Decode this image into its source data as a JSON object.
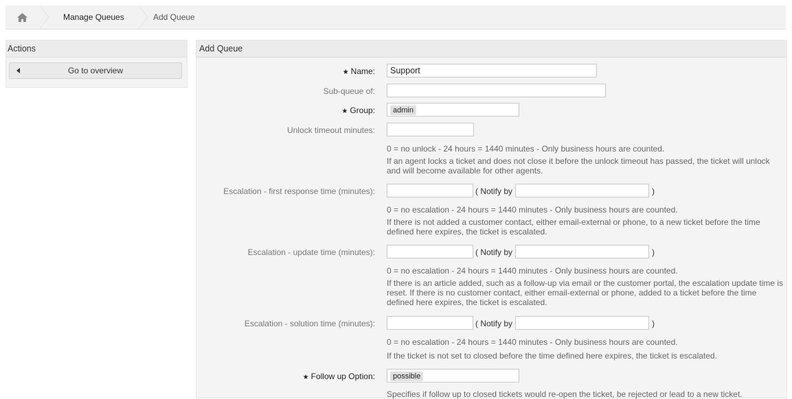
{
  "breadcrumb": {
    "home_icon": "home-icon",
    "items": [
      "Manage Queues",
      "Add Queue"
    ]
  },
  "sidebar": {
    "title": "Actions",
    "button_label": "Go to overview"
  },
  "main": {
    "title": "Add Queue",
    "fields": {
      "name": {
        "label": "Name:",
        "value": "Support",
        "required": true
      },
      "subqueue": {
        "label": "Sub-queue of:",
        "value": ""
      },
      "group": {
        "label": "Group:",
        "value": "admin",
        "required": true
      },
      "unlock": {
        "label": "Unlock timeout minutes:",
        "value": "",
        "help1": "0 = no unlock - 24 hours = 1440 minutes - Only business hours are counted.",
        "help2": "If an agent locks a ticket and does not close it before the unlock timeout has passed, the ticket will unlock and will become available for other agents."
      },
      "first_response": {
        "label": "Escalation - first response time (minutes):",
        "notify_label": "( Notify by",
        "close_paren": ")",
        "help1": "0 = no escalation - 24 hours = 1440 minutes - Only business hours are counted.",
        "help2": "If there is not added a customer contact, either email-external or phone, to a new ticket before the time defined here expires, the ticket is escalated."
      },
      "update": {
        "label": "Escalation - update time (minutes):",
        "notify_label": "( Notify by",
        "close_paren": ")",
        "help1": "0 = no escalation - 24 hours = 1440 minutes - Only business hours are counted.",
        "help2": "If there is an article added, such as a follow-up via email or the customer portal, the escalation update time is reset. If there is no customer contact, either email-external or phone, added to a ticket before the time defined here expires, the ticket is escalated."
      },
      "solution": {
        "label": "Escalation - solution time (minutes):",
        "notify_label": "( Notify by",
        "close_paren": ")",
        "help1": "0 = no escalation - 24 hours = 1440 minutes - Only business hours are counted.",
        "help2": "If the ticket is not set to closed before the time defined here expires, the ticket is escalated."
      },
      "follow_up": {
        "label": "Follow up Option:",
        "value": "possible",
        "required": true,
        "help": "Specifies if follow up to closed tickets would re-open the ticket, be rejected or lead to a new ticket."
      }
    }
  },
  "required_marker": "★"
}
